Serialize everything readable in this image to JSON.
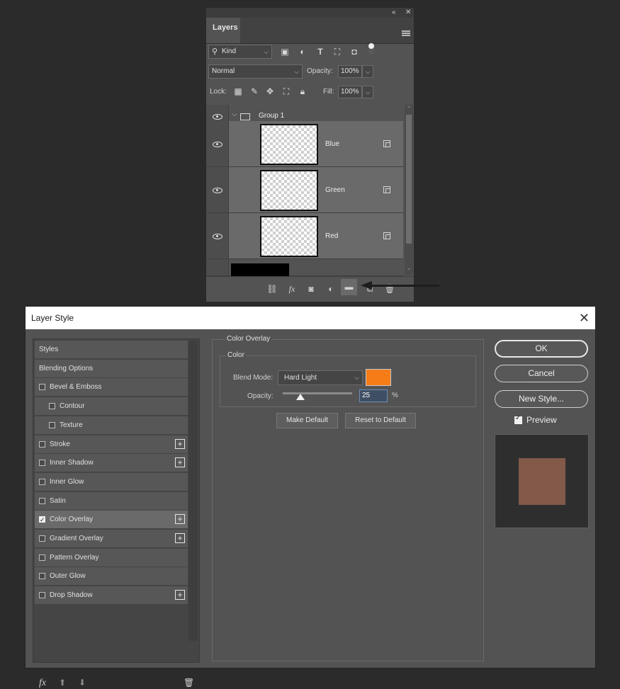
{
  "layers_panel": {
    "tab_label": "Layers",
    "filter": {
      "kind_label": "Kind"
    },
    "blend_mode": "Normal",
    "opacity_label": "Opacity:",
    "opacity_value": "100%",
    "lock_label": "Lock:",
    "fill_label": "Fill:",
    "fill_value": "100%",
    "group": {
      "name": "Group 1"
    },
    "layers": [
      {
        "name": "Blue"
      },
      {
        "name": "Green"
      },
      {
        "name": "Red"
      }
    ],
    "icons": [
      "search-icon",
      "image-filter-icon",
      "adjustment-filter-icon",
      "type-filter-icon",
      "shape-filter-icon",
      "smart-object-filter-icon",
      "filter-toggle-icon",
      "lock-pixels-icon",
      "lock-paint-icon",
      "lock-position-icon",
      "lock-artboard-icon",
      "lock-all-icon",
      "link-layers-icon",
      "fx-icon",
      "mask-icon",
      "adjustment-icon",
      "new-group-icon",
      "new-layer-icon",
      "trash-icon"
    ]
  },
  "dialog": {
    "title": "Layer Style",
    "style_list": [
      {
        "label": "Styles",
        "checkbox": false,
        "indent": 0,
        "plus": false,
        "selected": false
      },
      {
        "label": "Blending Options",
        "checkbox": false,
        "indent": 0,
        "plus": false,
        "selected": false
      },
      {
        "label": "Bevel & Emboss",
        "checkbox": true,
        "checked": false,
        "indent": 0,
        "plus": false,
        "selected": false
      },
      {
        "label": "Contour",
        "checkbox": true,
        "checked": false,
        "indent": 1,
        "plus": false,
        "selected": false
      },
      {
        "label": "Texture",
        "checkbox": true,
        "checked": false,
        "indent": 1,
        "plus": false,
        "selected": false
      },
      {
        "label": "Stroke",
        "checkbox": true,
        "checked": false,
        "indent": 0,
        "plus": true,
        "selected": false
      },
      {
        "label": "Inner Shadow",
        "checkbox": true,
        "checked": false,
        "indent": 0,
        "plus": true,
        "selected": false
      },
      {
        "label": "Inner Glow",
        "checkbox": true,
        "checked": false,
        "indent": 0,
        "plus": false,
        "selected": false
      },
      {
        "label": "Satin",
        "checkbox": true,
        "checked": false,
        "indent": 0,
        "plus": false,
        "selected": false
      },
      {
        "label": "Color Overlay",
        "checkbox": true,
        "checked": true,
        "indent": 0,
        "plus": true,
        "selected": true
      },
      {
        "label": "Gradient Overlay",
        "checkbox": true,
        "checked": false,
        "indent": 0,
        "plus": true,
        "selected": false
      },
      {
        "label": "Pattern Overlay",
        "checkbox": true,
        "checked": false,
        "indent": 0,
        "plus": false,
        "selected": false
      },
      {
        "label": "Outer Glow",
        "checkbox": true,
        "checked": false,
        "indent": 0,
        "plus": false,
        "selected": false
      },
      {
        "label": "Drop Shadow",
        "checkbox": true,
        "checked": false,
        "indent": 0,
        "plus": true,
        "selected": false
      }
    ],
    "fx_label": "fx",
    "color_overlay": {
      "section_title": "Color Overlay",
      "group_title": "Color",
      "blend_mode_label": "Blend Mode:",
      "blend_mode_value": "Hard Light",
      "overlay_color": "#f57c16",
      "opacity_label": "Opacity:",
      "opacity_value": "25",
      "opacity_fraction": 0.25,
      "percent": "%",
      "make_default": "Make Default",
      "reset_default": "Reset to Default"
    },
    "buttons": {
      "ok": "OK",
      "cancel": "Cancel",
      "new_style": "New Style..."
    },
    "preview_label": "Preview",
    "preview_checked": true,
    "preview_color": "#83594a"
  }
}
